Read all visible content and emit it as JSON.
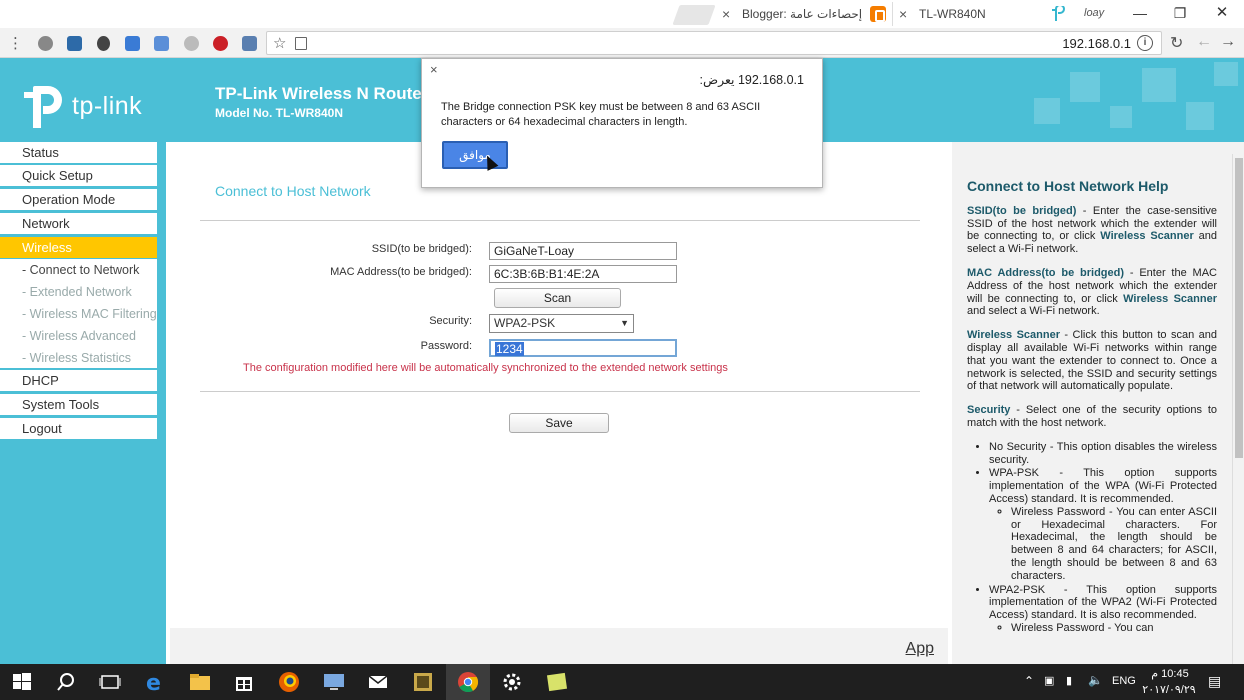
{
  "browser": {
    "tabs": [
      {
        "label": "Blogger: إحصاءات عامة -",
        "close": "×"
      },
      {
        "label": "TL-WR840N",
        "close": "×"
      }
    ],
    "user_chip": "loay",
    "url": "192.168.0.1"
  },
  "router": {
    "logo_text": "tp-link",
    "title": "TP-Link Wireless N Router",
    "model": "Model No. TL-WR840N",
    "menu": [
      {
        "label": "Status"
      },
      {
        "label": "Quick Setup"
      },
      {
        "label": "Operation Mode"
      },
      {
        "label": "Network"
      },
      {
        "label": "Wireless"
      },
      {
        "label": "DHCP"
      },
      {
        "label": "System Tools"
      },
      {
        "label": "Logout"
      }
    ],
    "submenu": [
      {
        "label": "- Connect to Network"
      },
      {
        "label": "- Extended Network"
      },
      {
        "label": "- Wireless MAC Filtering"
      },
      {
        "label": "- Wireless Advanced"
      },
      {
        "label": "- Wireless Statistics"
      }
    ],
    "section_title": "Connect to Host Network",
    "form": {
      "ssid_label": "SSID(to be bridged):",
      "ssid_value": "GiGaNeT-Loay",
      "mac_label": "MAC Address(to be bridged):",
      "mac_value": "6C:3B:6B:B1:4E:2A",
      "scan_label": "Scan",
      "security_label": "Security:",
      "security_value": "WPA2-PSK",
      "password_label": "Password:",
      "password_value": "1234",
      "sync_note": "The configuration modified here will be automatically synchronized to the extended network settings",
      "save_label": "Save"
    },
    "app_link": "App"
  },
  "help": {
    "title": "Connect to Host Network Help",
    "p1_term": "SSID(to be bridged)",
    "p1_text": " - Enter the case-sensitive SSID of the host network which the extender will be connecting to, or click ",
    "p1_link": "Wireless Scanner",
    "p1_tail": " and select a Wi-Fi network.",
    "p2_term": "MAC Address(to be bridged)",
    "p2_text": " - Enter the MAC Address of the host network which the extender will be connecting to, or click ",
    "p2_link": "Wireless Scanner",
    "p2_tail": " and select a Wi-Fi network.",
    "p3_term": "Wireless Scanner",
    "p3_text": " - Click this button to scan and display all available Wi-Fi networks within range that you want the extender to connect to. Once a network is selected, the SSID and security settings of that network will automatically populate.",
    "p4_term": "Security",
    "p4_text": " - Select one of the security options to match with the host network.",
    "li1": "No Security - This option disables the wireless security.",
    "li2": "WPA-PSK - This option supports implementation of the WPA (Wi-Fi Protected Access) standard. It is recommended.",
    "li2_sub": "Wireless Password - You can enter ASCII or Hexadecimal characters. For Hexadecimal, the length should be between 8 and 64 characters; for ASCII, the length should be between 8 and 63 characters.",
    "li3": "WPA2-PSK - This option supports implementation of the WPA2 (Wi-Fi Protected Access) standard. It is also recommended.",
    "li3_sub": "Wireless Password - You can"
  },
  "alert": {
    "origin": "192.168.0.1 يعرض:",
    "message": "The Bridge connection PSK key must be between 8 and 63 ASCII characters or 64 hexadecimal characters in length.",
    "ok_label": "موافق",
    "close": "×"
  },
  "taskbar": {
    "lang": "ENG",
    "time": "10:45 م",
    "date": "٢٠١٧/٠٩/٢٩"
  },
  "colors": {
    "accent": "#4bbfd6",
    "active_menu": "#ffc600",
    "note": "#c8324a",
    "dialog_button": "#4a85e6"
  }
}
